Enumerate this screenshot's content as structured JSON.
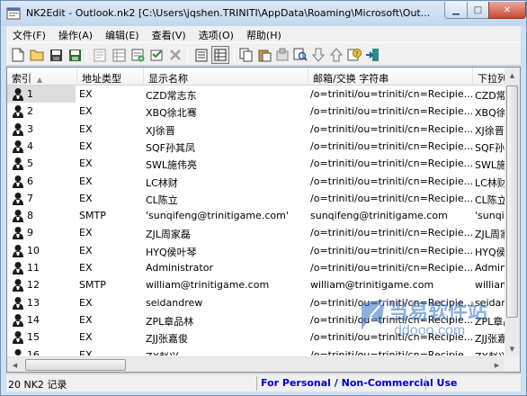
{
  "window": {
    "app_name": "NK2Edit",
    "file_name": "Outlook.nk2",
    "path": "[C:\\Users\\jqshen.TRINITI\\AppData\\Roaming\\Microsoft\\Out..."
  },
  "menu": [
    {
      "label": "文件(F)"
    },
    {
      "label": "操作(A)"
    },
    {
      "label": "编辑(E)"
    },
    {
      "label": "查看(V)"
    },
    {
      "label": "选项(O)"
    },
    {
      "label": "帮助(H)"
    }
  ],
  "toolbar": [
    {
      "name": "new-icon"
    },
    {
      "name": "open-icon"
    },
    {
      "name": "save-icon"
    },
    {
      "name": "save-as-icon"
    },
    {
      "name": "properties-icon"
    },
    {
      "name": "copy-table-icon"
    },
    {
      "name": "add-contact-icon"
    },
    {
      "name": "edit-contact-icon"
    },
    {
      "name": "delete-icon"
    },
    {
      "name": "list-view-icon"
    },
    {
      "name": "details-view-icon"
    },
    {
      "name": "copy-icon"
    },
    {
      "name": "paste-icon"
    },
    {
      "name": "export-icon"
    },
    {
      "name": "find-icon"
    },
    {
      "name": "arrow-down-icon"
    },
    {
      "name": "arrow-up-icon"
    },
    {
      "name": "help-icon"
    },
    {
      "name": "exit-icon"
    }
  ],
  "columns": [
    {
      "label": "索引"
    },
    {
      "label": "地址类型"
    },
    {
      "label": "显示名称"
    },
    {
      "label": "邮箱/交换 字符串"
    },
    {
      "label": "下拉列表"
    }
  ],
  "rows": [
    {
      "index": "1",
      "type": "EX",
      "name": "CZD常志东",
      "email": "/o=triniti/ou=triniti/cn=Recipie...",
      "dropdown": "CZD常志"
    },
    {
      "index": "2",
      "type": "EX",
      "name": "XBQ徐北骞",
      "email": "/o=triniti/ou=triniti/cn=Recipie...",
      "dropdown": "XBQ徐北"
    },
    {
      "index": "3",
      "type": "EX",
      "name": "XJ徐晋",
      "email": "/o=triniti/ou=triniti/cn=Recipie...",
      "dropdown": "XJ徐晋"
    },
    {
      "index": "4",
      "type": "EX",
      "name": "SQF孙其凤",
      "email": "/o=triniti/ou=triniti/cn=Recipie...",
      "dropdown": "SQF孙其"
    },
    {
      "index": "5",
      "type": "EX",
      "name": "SWL施伟亮",
      "email": "/o=triniti/ou=triniti/cn=Recipie...",
      "dropdown": "SWL施伟"
    },
    {
      "index": "6",
      "type": "EX",
      "name": "LC林财",
      "email": "/o=triniti/ou=triniti/cn=Recipie...",
      "dropdown": "LC林财"
    },
    {
      "index": "7",
      "type": "EX",
      "name": "CL陈立",
      "email": "/o=triniti/ou=triniti/cn=Recipie...",
      "dropdown": "CL陈立"
    },
    {
      "index": "8",
      "type": "SMTP",
      "name": "'sunqifeng@trinitigame.com'",
      "email": "sunqifeng@trinitigame.com",
      "dropdown": "'sunqif"
    },
    {
      "index": "9",
      "type": "EX",
      "name": "ZJL周家磊",
      "email": "/o=triniti/ou=triniti/cn=Recipie...",
      "dropdown": "ZJL周家"
    },
    {
      "index": "10",
      "type": "EX",
      "name": "HYQ侯叶琴",
      "email": "/o=triniti/ou=triniti/cn=Recipie...",
      "dropdown": "HYQ侯叶"
    },
    {
      "index": "11",
      "type": "EX",
      "name": "Administrator",
      "email": "/o=triniti/ou=triniti/cn=Recipie...",
      "dropdown": "Admini"
    },
    {
      "index": "12",
      "type": "SMTP",
      "name": "william@trinitigame.com",
      "email": "william@trinitigame.com",
      "dropdown": "william"
    },
    {
      "index": "13",
      "type": "EX",
      "name": "seidandrew",
      "email": "/o=triniti/ou=triniti/cn=Recipie...",
      "dropdown": "seidan"
    },
    {
      "index": "14",
      "type": "EX",
      "name": "ZPL章品林",
      "email": "/o=triniti/ou=triniti/cn=Recipie...",
      "dropdown": "ZPL章品"
    },
    {
      "index": "15",
      "type": "EX",
      "name": "ZJJ张嘉俊",
      "email": "/o=triniti/ou=triniti/cn=Recipie...",
      "dropdown": "ZJJ张嘉"
    },
    {
      "index": "16",
      "type": "EX",
      "name": "ZX赵兴",
      "email": "/o=triniti/ou=triniti/cn=Recipie...",
      "dropdown": "ZX赵兴"
    }
  ],
  "watermark": {
    "name": "当易软件站",
    "url": "ddooo.com"
  },
  "status": {
    "count": "20 NK2 记录",
    "license": "For Personal / Non-Commercial Use"
  },
  "colors": {
    "license_text": "#0000c8",
    "title_bar": "#c2d6ee",
    "selection": "#dddddd"
  }
}
